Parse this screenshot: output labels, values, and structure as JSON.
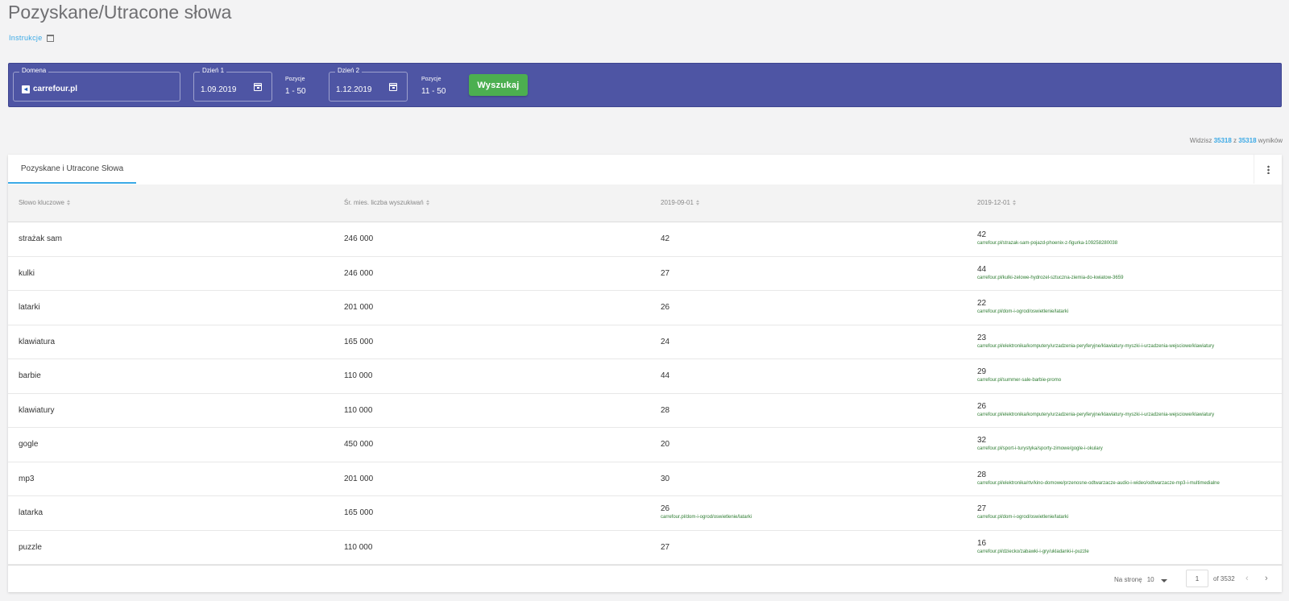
{
  "page": {
    "title": "Pozyskane/Utracone słowa",
    "instructions_link": "Instrukcje"
  },
  "search": {
    "domain_label": "Domena",
    "domain_value": "carrefour.pl",
    "day1_label": "Dzień 1",
    "day1_value": "1.09.2019",
    "pos1_label": "Pozycje",
    "pos1_value": "1 - 50",
    "day2_label": "Dzień 2",
    "day2_value": "1.12.2019",
    "pos2_label": "Pozycje",
    "pos2_value": "11 - 50",
    "button_label": "Wyszukaj"
  },
  "results": {
    "prefix": "Widzisz",
    "shown": "35318",
    "sep": "z",
    "total": "35318",
    "suffix": "wyników"
  },
  "table": {
    "tab_label": "Pozyskane i Utracone Słowa",
    "columns": [
      "Słowo kluczowe",
      "Śr. mies. liczba wyszukiwań",
      "2019-09-01",
      "2019-12-01"
    ],
    "rows": [
      {
        "keyword": "strażak sam",
        "volume": "246 000",
        "d1": "42",
        "d1_url": "",
        "d2": "42",
        "d2_url": "carrefour.pl/strazak-sam-pojazd-phoenix-z-figurka-109258280038"
      },
      {
        "keyword": "kulki",
        "volume": "246 000",
        "d1": "27",
        "d1_url": "",
        "d2": "44",
        "d2_url": "carrefour.pl/kulki-zelowe-hydrozel-sztuczna-ziemia-do-kwiatow-3659"
      },
      {
        "keyword": "latarki",
        "volume": "201 000",
        "d1": "26",
        "d1_url": "",
        "d2": "22",
        "d2_url": "carrefour.pl/dom-i-ogrod/oswietlenie/latarki"
      },
      {
        "keyword": "klawiatura",
        "volume": "165 000",
        "d1": "24",
        "d1_url": "",
        "d2": "23",
        "d2_url": "carrefour.pl/elektronika/komputery/urzadzenia-peryferyjne/klawiatury-myszki-i-urzadzenia-wejsciowe/klawiatury"
      },
      {
        "keyword": "barbie",
        "volume": "110 000",
        "d1": "44",
        "d1_url": "",
        "d2": "29",
        "d2_url": "carrefour.pl/summer-sale-barbie-promo"
      },
      {
        "keyword": "klawiatury",
        "volume": "110 000",
        "d1": "28",
        "d1_url": "",
        "d2": "26",
        "d2_url": "carrefour.pl/elektronika/komputery/urzadzenia-peryferyjne/klawiatury-myszki-i-urzadzenia-wejsciowe/klawiatury"
      },
      {
        "keyword": "gogle",
        "volume": "450 000",
        "d1": "20",
        "d1_url": "",
        "d2": "32",
        "d2_url": "carrefour.pl/sport-i-turystyka/sporty-zimowe/gogle-i-okulary"
      },
      {
        "keyword": "mp3",
        "volume": "201 000",
        "d1": "30",
        "d1_url": "",
        "d2": "28",
        "d2_url": "carrefour.pl/elektronika/rtv/kino-domowe/przenosne-odtwarzacze-audio-i-wideo/odtwarzacze-mp3-i-multimedialne"
      },
      {
        "keyword": "latarka",
        "volume": "165 000",
        "d1": "26",
        "d1_url": "carrefour.pl/dom-i-ogrod/oswietlenie/latarki",
        "d2": "27",
        "d2_url": "carrefour.pl/dom-i-ogrod/oswietlenie/latarki"
      },
      {
        "keyword": "puzzle",
        "volume": "110 000",
        "d1": "27",
        "d1_url": "",
        "d2": "16",
        "d2_url": "carrefour.pl/dziecko/zabawki-i-gry/ukladanki-i-puzzle"
      }
    ]
  },
  "pagination": {
    "per_page_label": "Na stronę",
    "per_page_value": "10",
    "current_page": "1",
    "of_pages": "of 3532",
    "prev_icon": "chevron-left-icon",
    "next_icon": "chevron-right-icon"
  },
  "colors": {
    "search_bar": "#4e55a4",
    "button": "#4caf50",
    "accent": "#3aa9e6",
    "url": "#2e7d32"
  }
}
